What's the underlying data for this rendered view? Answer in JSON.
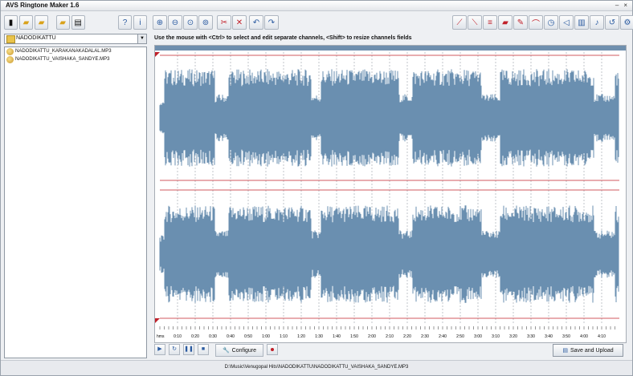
{
  "window": {
    "title": "AVS Ringtone Maker 1.6",
    "minimize": "–",
    "close": "×"
  },
  "left": {
    "toolbar": [
      "folder-open-icon",
      "folder-add-icon",
      "folder-up-icon",
      "folder-icon",
      "list-icon",
      "help-icon",
      "info-icon"
    ],
    "folder_select": "NADODIKATTU",
    "files": [
      "NADODIKATTU_KARAKANAKADALAL.MP3",
      "NADODIKATTU_VAISHAKA_SANDYE.MP3"
    ]
  },
  "right": {
    "zoom_buttons": [
      "zoom-in-icon",
      "zoom-out-icon",
      "zoom-selection-icon",
      "zoom-all-icon"
    ],
    "edit_buttons": [
      "cut-icon",
      "delete-icon"
    ],
    "undo_redo": [
      "undo-icon",
      "redo-icon"
    ],
    "effects": [
      "fade-in-icon",
      "fade-out-icon",
      "normalize-icon",
      "eraser-icon",
      "pencil-icon",
      "invert-icon",
      "reverse-icon",
      "stopwatch-icon",
      "speaker-icon",
      "equalizer-icon",
      "pitch-icon",
      "repeat-icon",
      "settings-icon"
    ],
    "hint": "Use the mouse with <Ctrl> to select and edit separate channels, <Shift> to resize channels fields",
    "ruler_start": "hms",
    "ruler_labels": [
      "0:10",
      "0:20",
      "0:30",
      "0:40",
      "0:50",
      "1:00",
      "1:10",
      "1:20",
      "1:30",
      "1:40",
      "1:50",
      "2:00",
      "2:10",
      "2:20",
      "2:30",
      "2:40",
      "2:50",
      "3:00",
      "3:10",
      "3:20",
      "3:30",
      "3:40",
      "3:50",
      "4:00",
      "4:10"
    ]
  },
  "controls": {
    "play": "▶",
    "loop": "↻",
    "pause": "❚❚",
    "stop": "■",
    "configure_label": "Configure",
    "save_label": "Save and Upload"
  },
  "status": {
    "path": "D:\\Music\\Venugopal Hits\\NADODIKATTU\\NADODIKATTU_VAISHAKA_SANDYE.MP3"
  },
  "colors": {
    "waveform": "#6a8fb0",
    "marker": "#c0202a",
    "accent": "#2a5aa0"
  }
}
